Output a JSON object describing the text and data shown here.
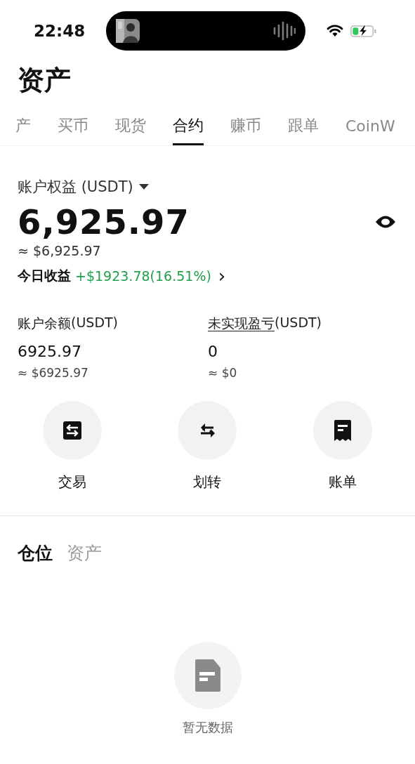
{
  "status_bar": {
    "time": "22:48",
    "charging": true
  },
  "title": "资产",
  "tabs": [
    {
      "label": "产",
      "selected": false
    },
    {
      "label": "买币",
      "selected": false
    },
    {
      "label": "现货",
      "selected": false
    },
    {
      "label": "合约",
      "selected": true
    },
    {
      "label": "赚币",
      "selected": false
    },
    {
      "label": "跟单",
      "selected": false
    },
    {
      "label": "CoinW",
      "selected": false
    }
  ],
  "equity": {
    "label": "账户权益 (USDT)",
    "value": "6,925.97",
    "approx": "≈ $6,925.97",
    "today_label": "今日收益",
    "today_value": "+$1923.78(16.51%)",
    "today_arrow": "›"
  },
  "stats": [
    {
      "kind": "plain",
      "label": "账户余额",
      "suffix": "(USDT)",
      "value": "6925.97",
      "approx": "≈ $6925.97"
    },
    {
      "kind": "tooltip",
      "label": "未实现盈亏",
      "suffix": "(USDT)",
      "value": "0",
      "approx": "≈ $0"
    }
  ],
  "actions": [
    {
      "kind": "trade",
      "label": "交易"
    },
    {
      "kind": "transfer",
      "label": "划转"
    },
    {
      "kind": "bill",
      "label": "账单"
    }
  ],
  "section_tabs": [
    {
      "label": "仓位",
      "selected": true
    },
    {
      "label": "资产",
      "selected": false
    }
  ],
  "empty_state": {
    "text": "暂无数据"
  }
}
